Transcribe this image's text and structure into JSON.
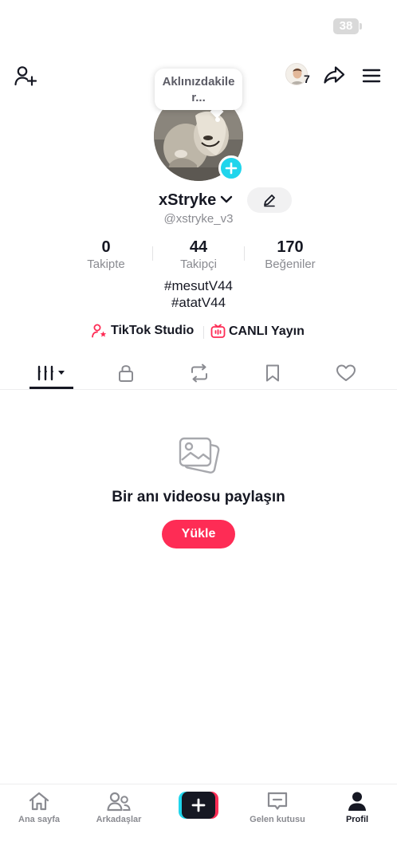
{
  "status_bar": {
    "battery_level": "38"
  },
  "header": {
    "avatar_count": "7"
  },
  "note": {
    "text": "Aklınızdakiler..."
  },
  "profile": {
    "username": "xStryke",
    "handle": "@xstryke_v3",
    "stats": [
      {
        "value": "0",
        "label": "Takipte"
      },
      {
        "value": "44",
        "label": "Takipçi"
      },
      {
        "value": "170",
        "label": "Beğeniler"
      }
    ],
    "bio_lines": [
      "#mesutV44",
      "#atatV44"
    ]
  },
  "links": {
    "studio": "TikTok Studio",
    "live": "CANLI Yayın"
  },
  "colors": {
    "accent": "#fe2c55",
    "cyan": "#20d5ec",
    "text": "#161823",
    "muted": "#8a8b91"
  },
  "empty_state": {
    "title": "Bir anı videosu paylaşın",
    "button": "Yükle"
  },
  "bottom_nav": {
    "home": "Ana sayfa",
    "friends": "Arkadaşlar",
    "inbox": "Gelen kutusu",
    "profile": "Profil"
  }
}
